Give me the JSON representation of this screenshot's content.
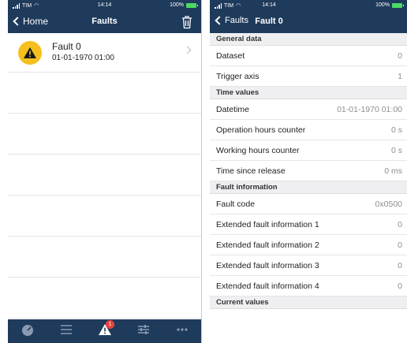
{
  "status_bar": {
    "carrier": "TIM",
    "time": "14:14",
    "battery": "100%"
  },
  "left_screen": {
    "nav": {
      "back_label": "Home",
      "title": "Faults"
    },
    "faults": [
      {
        "name": "Fault 0",
        "date": "01-01-1970 01:00"
      }
    ],
    "tab_bar": {
      "tabs": [
        {
          "icon": "gauge-icon"
        },
        {
          "icon": "list-icon"
        },
        {
          "icon": "warning-icon",
          "badge": "1"
        },
        {
          "icon": "sliders-icon"
        },
        {
          "icon": "more-icon"
        }
      ]
    }
  },
  "right_screen": {
    "nav": {
      "back_label": "Faults",
      "title": "Fault 0"
    },
    "sections": [
      {
        "title": "General data",
        "rows": [
          {
            "label": "Dataset",
            "value": "0"
          },
          {
            "label": "Trigger axis",
            "value": "1"
          }
        ]
      },
      {
        "title": "Time values",
        "rows": [
          {
            "label": "Datetime",
            "value": "01-01-1970 01:00"
          },
          {
            "label": "Operation hours counter",
            "value": "0 s"
          },
          {
            "label": "Working hours counter",
            "value": "0 s"
          },
          {
            "label": "Time since release",
            "value": "0 ms"
          }
        ]
      },
      {
        "title": "Fault information",
        "rows": [
          {
            "label": "Fault code",
            "value": "0x0500"
          },
          {
            "label": "Extended fault information 1",
            "value": "0"
          },
          {
            "label": "Extended fault information 2",
            "value": "0"
          },
          {
            "label": "Extended fault information 3",
            "value": "0"
          },
          {
            "label": "Extended fault information 4",
            "value": "0"
          }
        ]
      },
      {
        "title": "Current values",
        "rows": []
      }
    ]
  },
  "colors": {
    "nav_bg": "#1f3b5c",
    "warning": "#f5bf1d",
    "badge": "#e8423f",
    "battery": "#4cd964",
    "section_bg": "#efeff2"
  }
}
